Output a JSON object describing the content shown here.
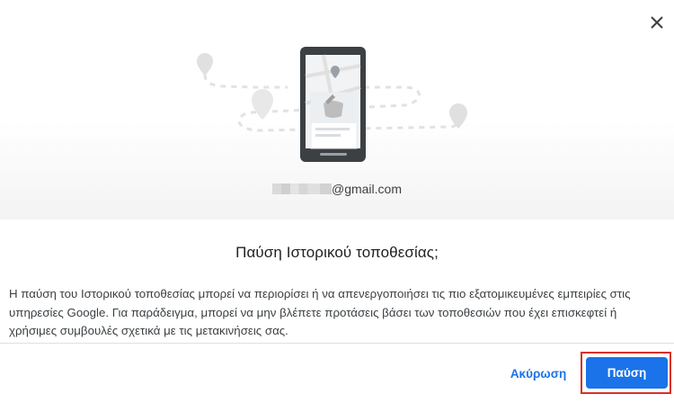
{
  "dialog": {
    "close_icon": "close-icon",
    "account_email": "@gmail.com",
    "title": "Παύση Ιστορικού τοποθεσίας;",
    "body": "Η παύση του Ιστορικού τοποθεσίας μπορεί να περιορίσει ή να απενεργοποιήσει τις πιο εξατομικευμένες εμπειρίες στις υπηρεσίες Google. Για παράδειγμα, μπορεί να μην βλέπετε προτάσεις βάσει των τοποθεσιών που έχει επισκεφτεί ή χρήσιμες συμβουλές σχετικά με τις μετακινήσεις σας.",
    "cancel_label": "Ακύρωση",
    "pause_label": "Παύση"
  },
  "colors": {
    "accent": "#1a73e8",
    "highlight": "#d93025"
  }
}
